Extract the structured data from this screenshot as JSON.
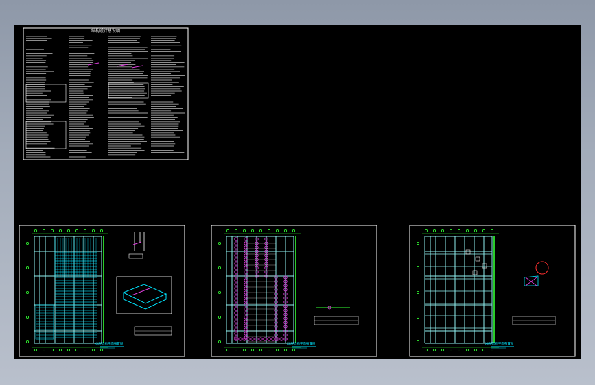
{
  "viewport": {
    "background": "#000000",
    "label": "CAD model space viewport"
  },
  "colors": {
    "frame": "#ffffff",
    "grid": "#8ff0f0",
    "cyan": "#00e5ff",
    "green": "#33ff33",
    "magenta": "#e040e0",
    "red": "#ff3030",
    "text": "#e8e8e8"
  },
  "general_notes_sheet": {
    "title": "结构设计总说明"
  },
  "sheets": [
    {
      "id": "sheet-1",
      "title": "XX层结构平面布置图",
      "has_detail_view": true
    },
    {
      "id": "sheet-2",
      "title": "XX层结构平面布置图",
      "has_detail_view": false
    },
    {
      "id": "sheet-3",
      "title": "XX层结构平面布置图",
      "has_detail_view": false
    }
  ]
}
